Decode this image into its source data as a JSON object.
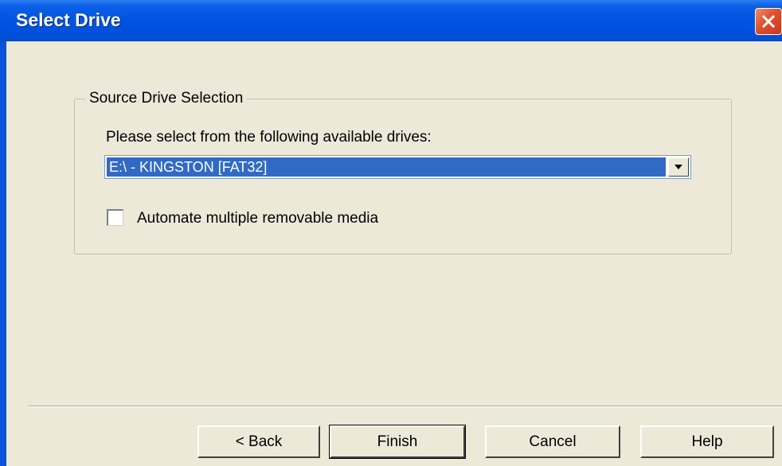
{
  "window": {
    "title": "Select Drive"
  },
  "source_group": {
    "legend": "Source Drive Selection",
    "prompt": "Please select from the following available drives:",
    "drive_select": {
      "selected": "E:\\ - KINGSTON [FAT32]"
    },
    "automate_checkbox": {
      "label": "Automate multiple removable media",
      "checked": false
    }
  },
  "buttons": {
    "back": "< Back",
    "finish": "Finish",
    "cancel": "Cancel",
    "help": "Help"
  },
  "colors": {
    "titlebar": "#0053e1",
    "window_face": "#ece9d8",
    "selection": "#316ac5",
    "close_button": "#e0502e"
  },
  "icons": {
    "close": "close-icon",
    "dropdown": "chevron-down-icon"
  }
}
